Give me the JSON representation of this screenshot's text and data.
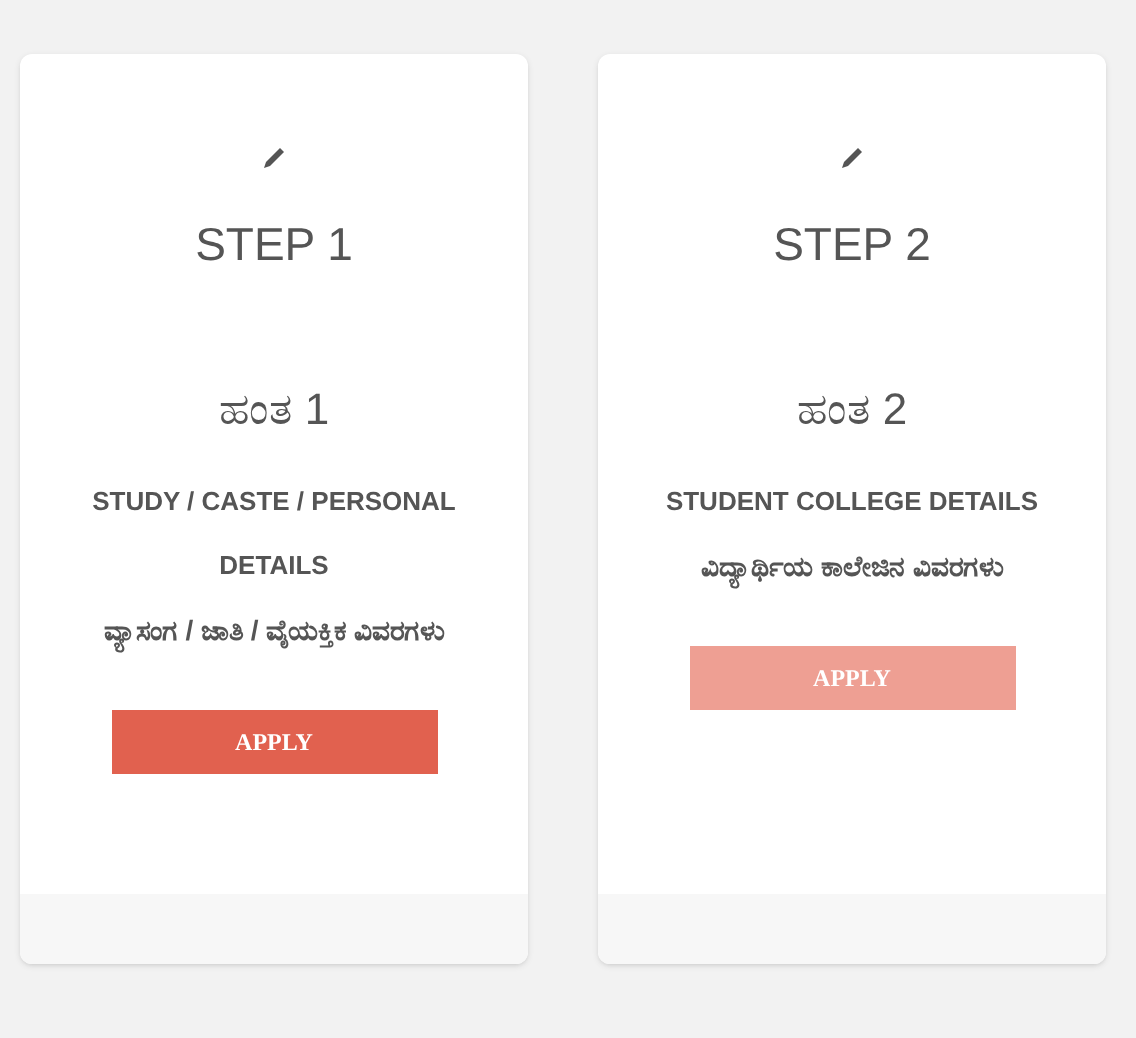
{
  "cards": [
    {
      "step": "STEP 1",
      "step_kannada": "ಹಂತ 1",
      "title": "STUDY / CASTE / PERSONAL DETAILS",
      "title_kannada": "ವ್ಯಾಸಂಗ / ಜಾತಿ / ವೈಯಕ್ತಿಕ ವಿವರಗಳು",
      "button": {
        "label": "APPLY",
        "disabled": false
      }
    },
    {
      "step": "STEP 2",
      "step_kannada": "ಹಂತ 2",
      "title": "STUDENT COLLEGE DETAILS",
      "title_kannada": "ವಿದ್ಯಾರ್ಥಿಯ ಕಾಲೇಜಿನ ವಿವರಗಳು",
      "button": {
        "label": "APPLY",
        "disabled": true
      }
    }
  ]
}
